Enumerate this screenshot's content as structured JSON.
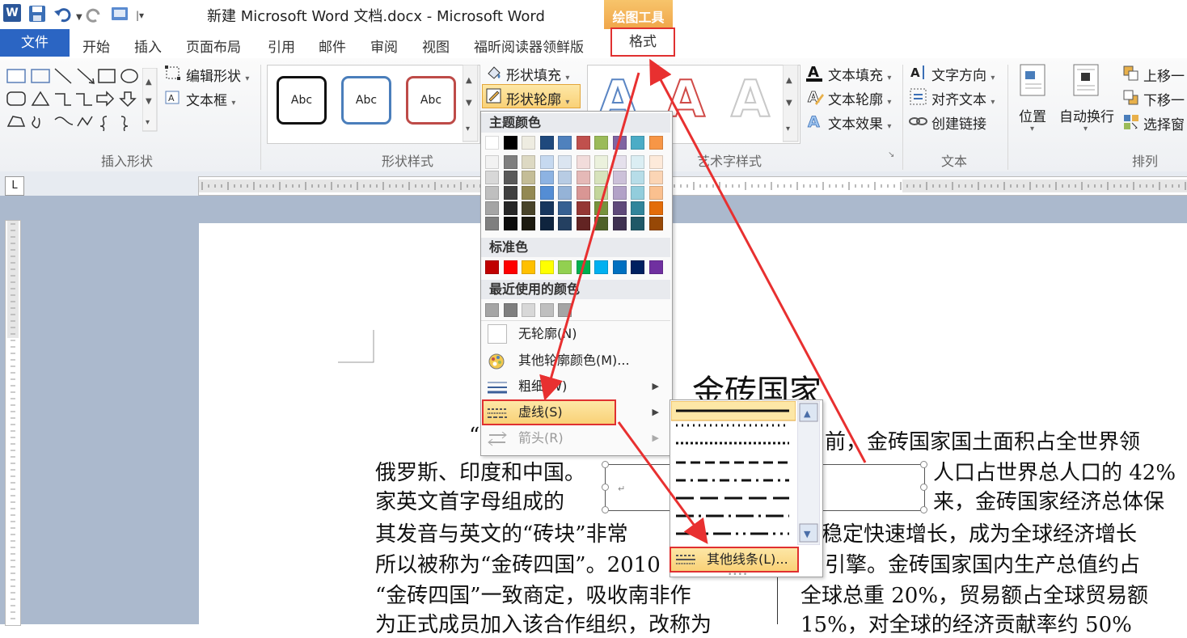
{
  "window": {
    "title": "新建 Microsoft Word 文档.docx - Microsoft Word",
    "app_icon": "W",
    "context_tab_group": "绘图工具"
  },
  "tabs": {
    "file": "文件",
    "items": [
      "开始",
      "插入",
      "页面布局",
      "引用",
      "邮件",
      "审阅",
      "视图",
      "福昕阅读器领鲜版"
    ],
    "format": "格式"
  },
  "ribbon": {
    "insert_shapes": {
      "label": "插入形状",
      "edit_shape": "编辑形状",
      "text_box": "文本框"
    },
    "shape_styles": {
      "label": "形状样式",
      "samples": [
        "Abc",
        "Abc",
        "Abc"
      ],
      "fill": "形状填充",
      "outline": "形状轮廓"
    },
    "wordart_styles": {
      "label": "艺术字样式",
      "text_fill": "文本填充",
      "text_outline": "文本轮廓",
      "text_effects": "文本效果"
    },
    "text": {
      "label": "文本",
      "direction": "文字方向",
      "align": "对齐文本",
      "link": "创建链接"
    },
    "arrange": {
      "label": "排列",
      "position": "位置",
      "wrap": "自动换行",
      "bring_forward": "上移一",
      "send_backward": "下移一",
      "selection_pane": "选择窗"
    }
  },
  "outline_menu": {
    "theme_colors_header": "主题颜色",
    "theme_top": [
      "#ffffff",
      "#000000",
      "#eeece1",
      "#1f497d",
      "#4f81bd",
      "#c0504d",
      "#9bbb59",
      "#8064a2",
      "#4bacc6",
      "#f79646"
    ],
    "theme_shades": [
      [
        "#f2f2f2",
        "#7f7f7f",
        "#ddd9c3",
        "#c6d9f0",
        "#dbe5f1",
        "#f2dcdb",
        "#ebf1dd",
        "#e5e0ec",
        "#dbeef3",
        "#fdeada"
      ],
      [
        "#d8d8d8",
        "#595959",
        "#c4bd97",
        "#8db3e2",
        "#b8cce4",
        "#e5b9b7",
        "#d7e3bc",
        "#ccc1d9",
        "#b7dde8",
        "#fbd5b5"
      ],
      [
        "#bfbfbf",
        "#3f3f3f",
        "#938953",
        "#548dd4",
        "#95b3d7",
        "#d99694",
        "#c3d69b",
        "#b2a2c7",
        "#92cddc",
        "#fac08f"
      ],
      [
        "#a5a5a5",
        "#262626",
        "#494429",
        "#17365d",
        "#366092",
        "#953734",
        "#76923c",
        "#5f497a",
        "#31859b",
        "#e36c09"
      ],
      [
        "#7f7f7f",
        "#0c0c0c",
        "#1d1b10",
        "#0f243e",
        "#244061",
        "#632423",
        "#4f6128",
        "#3f3151",
        "#205867",
        "#974806"
      ]
    ],
    "standard_colors_header": "标准色",
    "standard_colors": [
      "#c00000",
      "#ff0000",
      "#ffc000",
      "#ffff00",
      "#92d050",
      "#00b050",
      "#00b0f0",
      "#0070c0",
      "#002060",
      "#7030a0"
    ],
    "recent_colors_header": "最近使用的颜色",
    "recent_colors": [
      "#a5a5a5",
      "#7f7f7f",
      "#d8d8d8",
      "#bfbfbf",
      "#a5a5a5"
    ],
    "no_outline": "无轮廓(N)",
    "more_colors": "其他轮廓颜色(M)...",
    "weight": "粗细(W)",
    "dashes": "虚线(S)",
    "arrows": "箭头(R)"
  },
  "dash_submenu": {
    "more_lines": "其他线条(L)..."
  },
  "document": {
    "heading": "金砖国家",
    "left_lines": [
      "“",
      "俄罗斯、印度和中国。",
      "家英文首字母组成的",
      "其发音与英文的“砖块”非常",
      "所以被称为“金砖四国”。2010",
      "“金砖四国”一致商定，吸收南非作",
      "为正式成员加入该合作组织，改称为"
    ],
    "right_lines": [
      "前，金砖国家国土面积占全世界领",
      "人口占世界总人口的 42%",
      "来，金砖国家经济总体保",
      "稳定快速增长，成为全球经济增长",
      "引擎。金砖国家国内生产总值约占",
      "全球总重 20%，贸易额占全球贸易额",
      "15%，对全球的经济贡献率约 50%"
    ]
  }
}
